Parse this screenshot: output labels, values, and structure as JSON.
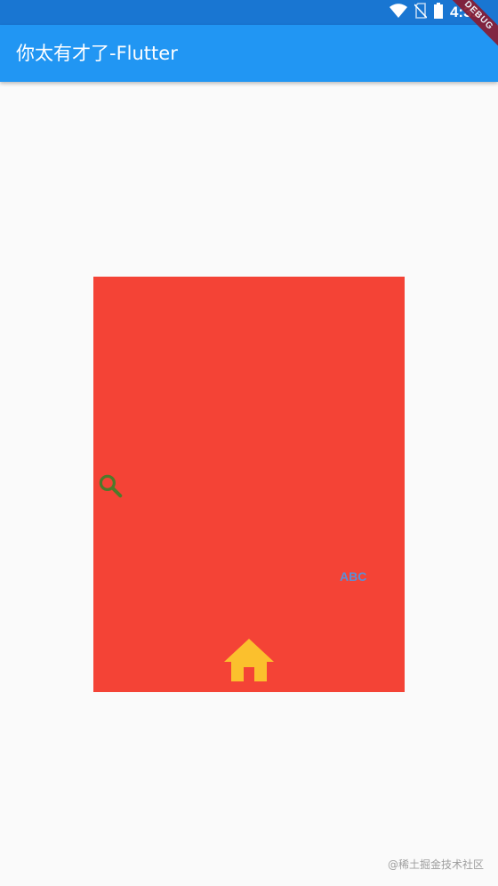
{
  "status_bar": {
    "time": "4:31",
    "icons": [
      "wifi-icon",
      "no-sim-icon",
      "battery-icon"
    ],
    "background": "#1976d2"
  },
  "app_bar": {
    "title": "你太有才了-Flutter",
    "background": "#2196f3"
  },
  "debug_banner": {
    "label": "DEBUG"
  },
  "content": {
    "box_color": "#f44336",
    "search_icon_color": "#4e7a2a",
    "abc_text": "ABC",
    "abc_color": "#5c8fd6",
    "home_icon_color": "#fbc02d"
  },
  "watermark": {
    "text": "@稀土掘金技术社区"
  }
}
